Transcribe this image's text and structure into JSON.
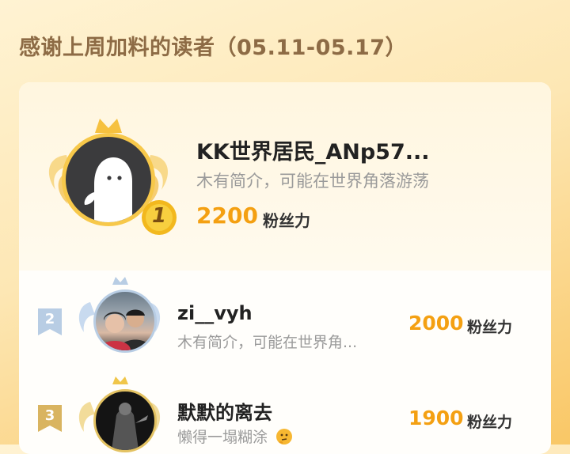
{
  "header": {
    "title": "感谢上周加料的读者（05.11-05.17）"
  },
  "readers": [
    {
      "rank": "1",
      "name": "KK世界居民_ANp57...",
      "desc": "木有简介，可能在世界角落游荡",
      "score": "2200",
      "unit": "粉丝力"
    },
    {
      "rank": "2",
      "name": "zi__vyh",
      "desc": "木有简介，可能在世界角...",
      "score": "2000",
      "unit": "粉丝力"
    },
    {
      "rank": "3",
      "name": "默默的离去",
      "desc": "懒得一塌糊涂",
      "score": "1900",
      "unit": "粉丝力"
    }
  ],
  "colors": {
    "gold": "#f4a012",
    "silver": "#b8cde4",
    "bronze": "#d9b460"
  }
}
